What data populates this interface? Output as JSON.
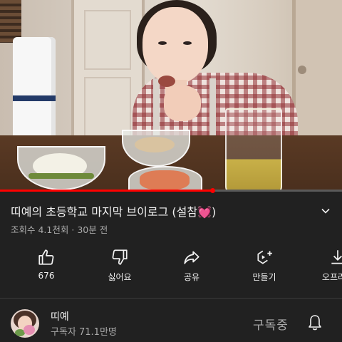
{
  "video": {
    "progress_fraction": 0.62
  },
  "title": {
    "text": "띠예의 초등학교 마지막 브이로그 (설참",
    "emoji": "💓",
    "close": ")"
  },
  "meta": {
    "views": "조회수 4.1천회",
    "separator": "·",
    "time_ago": "30분 전"
  },
  "actions": [
    {
      "label": "676",
      "icon": "thumbs-up-icon"
    },
    {
      "label": "싫어요",
      "icon": "thumbs-down-icon"
    },
    {
      "label": "공유",
      "icon": "share-icon"
    },
    {
      "label": "만들기",
      "icon": "create-icon"
    },
    {
      "label": "오프라인",
      "icon": "download-icon"
    }
  ],
  "channel": {
    "name": "띠예",
    "subscribers": "구독자 71.1만명",
    "subscribe_label": "구독중"
  },
  "colors": {
    "background": "#212121",
    "progress": "#ff0000",
    "heart": "#e03a8e",
    "secondary_text": "#aaaaaa"
  }
}
